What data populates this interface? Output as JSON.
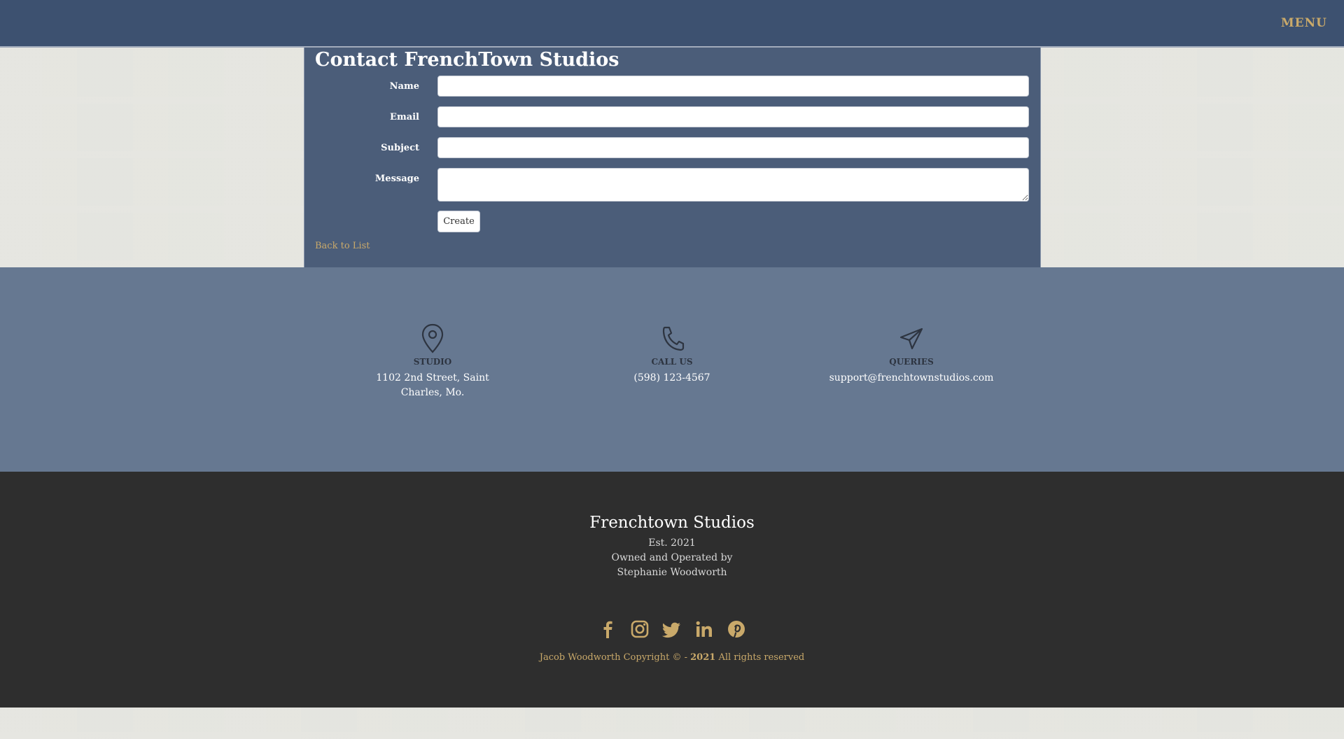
{
  "nav": {
    "menu_label": "MENU"
  },
  "form": {
    "title": "Contact FrenchTown Studios",
    "fields": [
      {
        "label": "Name",
        "value": ""
      },
      {
        "label": "Email",
        "value": ""
      },
      {
        "label": "Subject",
        "value": ""
      },
      {
        "label": "Message",
        "value": ""
      }
    ],
    "submit_label": "Create",
    "back_link": "Back to List"
  },
  "info": [
    {
      "icon": "map-pin-icon",
      "title": "STUDIO",
      "line1": "1102 2nd Street, Saint",
      "line2": "Charles, Mo."
    },
    {
      "icon": "phone-icon",
      "title": "CALL US",
      "line1": "(598) 123-4567",
      "line2": ""
    },
    {
      "icon": "paper-plane-icon",
      "title": "QUERIES",
      "line1": "support@frenchtownstudios.com",
      "line2": ""
    }
  ],
  "footer": {
    "name": "Frenchtown Studios",
    "line1": "Est. 2021",
    "line2": "Owned and Operated by",
    "line3": "Stephanie Woodworth",
    "socials": [
      "facebook-icon",
      "instagram-icon",
      "twitter-icon",
      "linkedin-icon",
      "pinterest-icon"
    ],
    "copyright_prefix": "Jacob Woodworth Copyright © - ",
    "copyright_year": "2021",
    "copyright_suffix": " All rights reserved"
  },
  "colors": {
    "nav": "#3d5170",
    "accent": "#c9a96a",
    "info_band": "#667891",
    "footer": "#2e2e2e"
  }
}
